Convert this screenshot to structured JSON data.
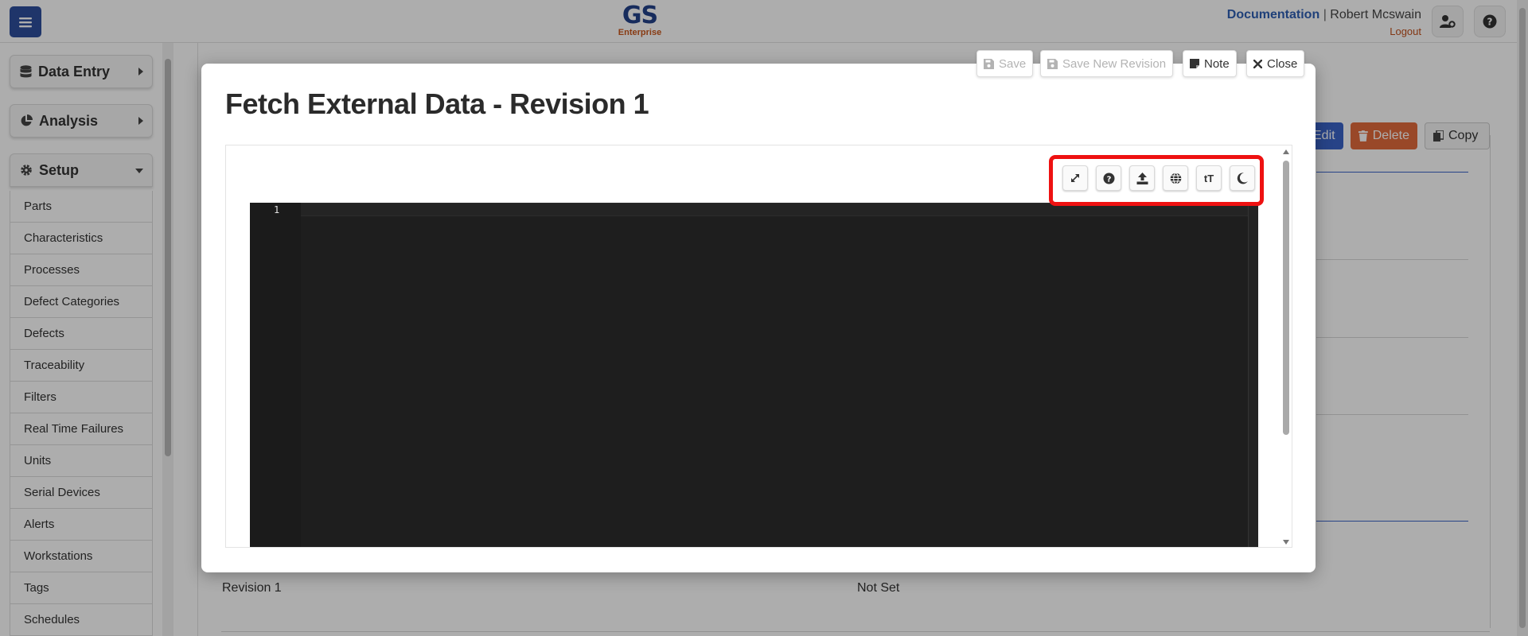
{
  "header": {
    "logo_main": "GS",
    "logo_sub": "Enterprise",
    "documentation_link": "Documentation",
    "separator": "|",
    "user_name": "Robert Mcswain",
    "logout_link": "Logout"
  },
  "sidebar": {
    "groups": [
      {
        "label": "Data Entry",
        "icon": "database-icon",
        "state": "collapsed"
      },
      {
        "label": "Analysis",
        "icon": "pie-chart-icon",
        "state": "collapsed"
      },
      {
        "label": "Setup",
        "icon": "gear-icon",
        "state": "expanded"
      }
    ],
    "setup_items": [
      "Parts",
      "Characteristics",
      "Processes",
      "Defect Categories",
      "Defects",
      "Traceability",
      "Filters",
      "Real Time Failures",
      "Units",
      "Serial Devices",
      "Alerts",
      "Workstations",
      "Tags",
      "Schedules"
    ]
  },
  "background": {
    "edit_label": "Edit",
    "delete_label": "Delete",
    "copy_label": "Copy",
    "revision_value": "Revision 1",
    "not_set_value": "Not Set"
  },
  "modal": {
    "title": "Fetch External Data - Revision 1",
    "buttons": {
      "save": "Save",
      "save_new_revision": "Save New Revision",
      "note": "Note",
      "close": "Close"
    },
    "toolbar": [
      {
        "icon": "expand-icon"
      },
      {
        "icon": "help-icon"
      },
      {
        "icon": "upload-icon"
      },
      {
        "icon": "globe-icon"
      },
      {
        "icon": "font-size-icon",
        "text": "tT"
      },
      {
        "icon": "moon-icon"
      }
    ],
    "editor": {
      "line_numbers": [
        "1"
      ],
      "theme": "dark"
    }
  },
  "colors": {
    "brand_blue": "#22418a",
    "brand_orange": "#c9571c",
    "link_blue": "#2f5fb3",
    "highlight_red": "#ee1111",
    "editor_bg": "#1e1e1e"
  }
}
